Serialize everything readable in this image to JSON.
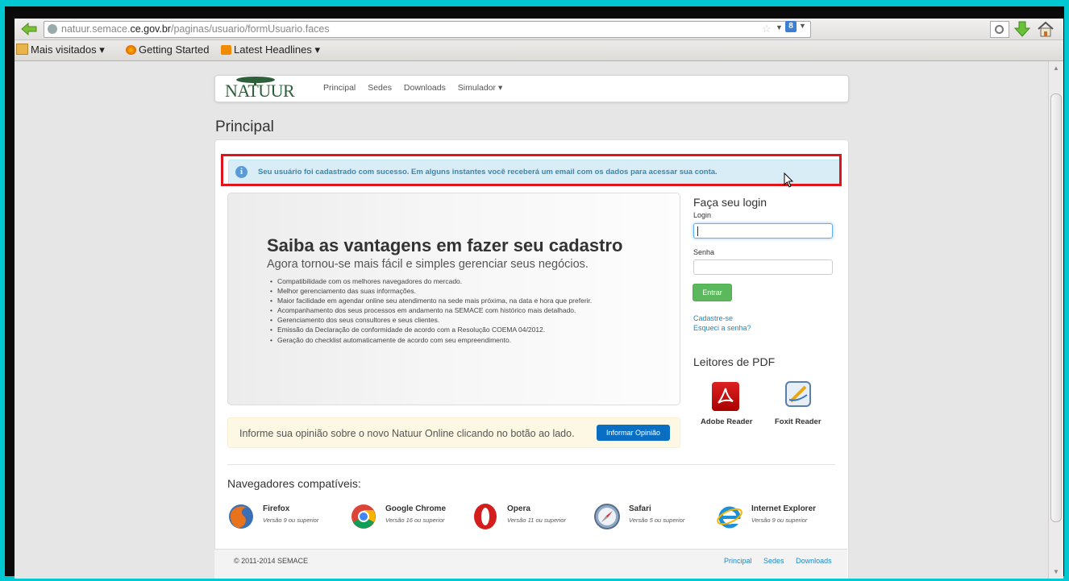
{
  "browser": {
    "url_prefix": "natuur.semace.",
    "url_domain": "ce.gov.br",
    "url_path": "/paginas/usuario/formUsuario.faces",
    "search_engine_label": "8",
    "bookmarks": [
      "Mais visitados ▾",
      "Getting Started",
      "Latest Headlines ▾"
    ]
  },
  "nav": {
    "logo": "NATUUR",
    "items": [
      "Principal",
      "Sedes",
      "Downloads",
      "Simulador ▾"
    ]
  },
  "page_title": "Principal",
  "alert": {
    "icon": "i",
    "text": "Seu usuário foi cadastrado com sucesso. Em alguns instantes você receberá um email com os dados para acessar sua conta."
  },
  "hero": {
    "title": "Saiba as vantagens em fazer seu cadastro",
    "subtitle": "Agora tornou-se mais fácil e simples gerenciar seus negócios.",
    "items": [
      "Compatibilidade com os melhores navegadores do mercado.",
      "Melhor gerenciamento das suas informações.",
      "Maior facilidade em agendar online seu atendimento na sede mais próxima, na data e hora que preferir.",
      "Acompanhamento dos seus processos em andamento na SEMACE com histórico mais detalhado.",
      "Gerenciamento dos seus consultores e seus clientes.",
      "Emissão da Declaração de conformidade de acordo com a Resolução COEMA 04/2012.",
      "Geração do checklist automaticamente de acordo com seu empreendimento."
    ]
  },
  "login": {
    "title": "Faça seu login",
    "login_label": "Login",
    "senha_label": "Senha",
    "submit": "Entrar",
    "register": "Cadastre-se",
    "forgot": "Esqueci a senha?"
  },
  "pdf": {
    "title": "Leitores de PDF",
    "readers": [
      "Adobe Reader",
      "Foxit Reader"
    ]
  },
  "opinion": {
    "text": "Informe sua opinião sobre o novo Natuur Online clicando no botão ao lado.",
    "button": "Informar Opinião"
  },
  "browsers": {
    "title": "Navegadores compatíveis:",
    "list": [
      {
        "name": "Firefox",
        "version": "Versão 9 ou superior",
        "icon": "firefox-icon"
      },
      {
        "name": "Google Chrome",
        "version": "Versão 16 ou superior",
        "icon": "chrome-icon"
      },
      {
        "name": "Opera",
        "version": "Versão 11 ou superior",
        "icon": "opera-icon"
      },
      {
        "name": "Safari",
        "version": "Versão 5 ou superior",
        "icon": "safari-icon"
      },
      {
        "name": "Internet Explorer",
        "version": "Versão 9 ou superior",
        "icon": "ie-icon"
      }
    ]
  },
  "footer": {
    "copyright": "© 2011-2014 SEMACE",
    "links": [
      "Principal",
      "Sedes",
      "Downloads"
    ]
  },
  "colors": {
    "frame_bg": "#00c8d2",
    "alert_bg": "#d9edf7",
    "alert_text": "#3a87ad",
    "highlight": "#e0151c",
    "btn_green": "#5cb85c",
    "btn_blue": "#0a6fc2",
    "link": "#1e88c5"
  }
}
